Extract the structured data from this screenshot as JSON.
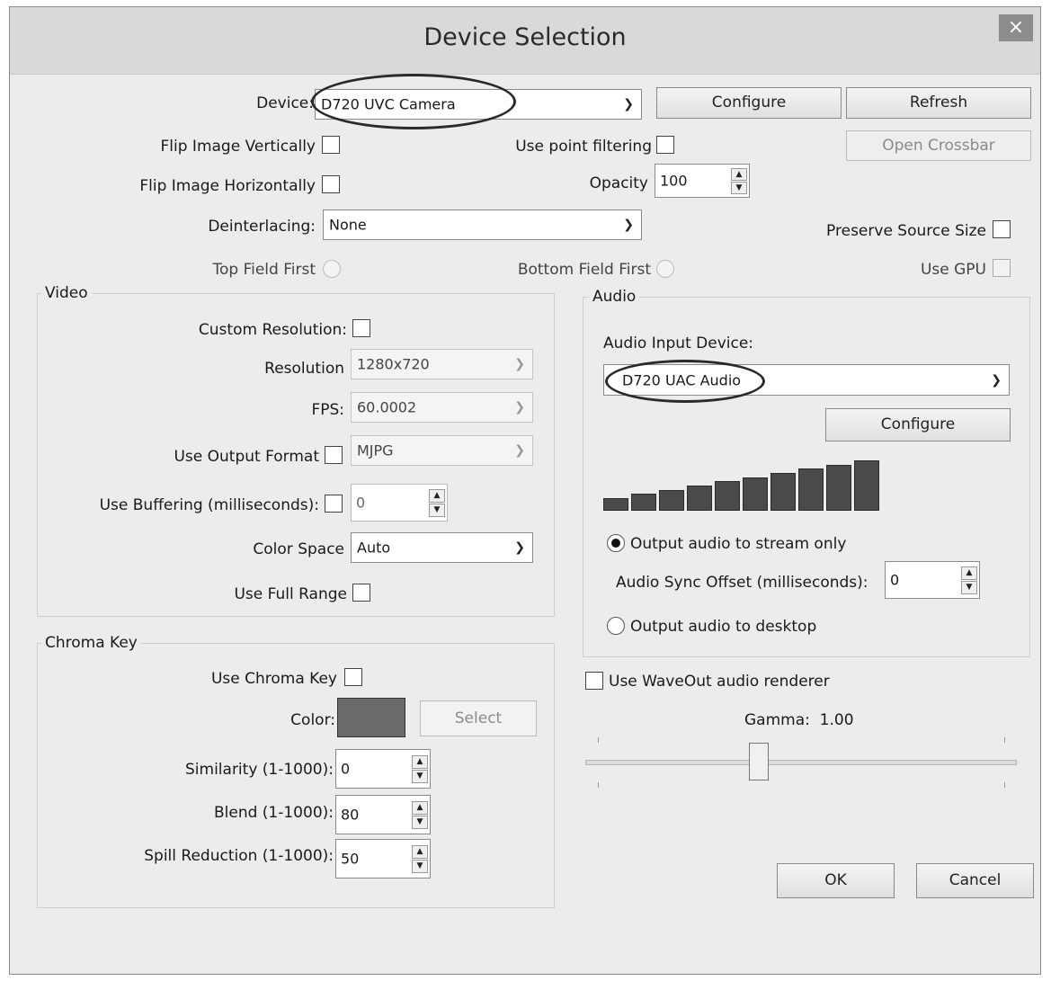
{
  "window": {
    "title": "Device Selection",
    "close_glyph": "×"
  },
  "device": {
    "label": "Device:",
    "selected": "D720 UVC Camera",
    "configure_label": "Configure",
    "refresh_label": "Refresh",
    "open_crossbar_label": "Open Crossbar"
  },
  "options": {
    "flip_vertical": "Flip Image Vertically",
    "flip_horizontal": "Flip Image Horizontally",
    "point_filtering": "Use point filtering",
    "opacity_label": "Opacity",
    "opacity_value": "100",
    "deinterlacing_label": "Deinterlacing:",
    "deinterlacing_value": "None",
    "preserve_source_size": "Preserve Source Size",
    "top_field_first": "Top Field First",
    "bottom_field_first": "Bottom Field First",
    "use_gpu": "Use GPU"
  },
  "video": {
    "group_title": "Video",
    "custom_resolution": "Custom Resolution:",
    "resolution_label": "Resolution",
    "resolution_value": "1280x720",
    "fps_label": "FPS:",
    "fps_value": "60.0002",
    "output_format_label": "Use Output Format",
    "output_format_value": "MJPG",
    "buffering_label": "Use Buffering (milliseconds):",
    "buffering_value": "0",
    "color_space_label": "Color Space",
    "color_space_value": "Auto",
    "full_range_label": "Use Full Range"
  },
  "chroma": {
    "group_title": "Chroma Key",
    "use_label": "Use Chroma Key",
    "color_label": "Color:",
    "swatch_color": "#6a6a6a",
    "select_label": "Select",
    "similarity_label": "Similarity (1-1000):",
    "similarity_value": "0",
    "blend_label": "Blend (1-1000):",
    "blend_value": "80",
    "spill_label": "Spill Reduction (1-1000):",
    "spill_value": "50"
  },
  "audio": {
    "group_title": "Audio",
    "input_label": "Audio Input Device:",
    "input_value": "D720 UAC Audio",
    "configure_label": "Configure",
    "meter_bar_count": 10,
    "meter_level": 1.0,
    "stream_only_label": "Output audio to stream only",
    "sync_label": "Audio Sync Offset (milliseconds):",
    "sync_value": "0",
    "desktop_label": "Output audio to desktop",
    "waveout_label": "Use WaveOut audio renderer",
    "gamma_label": "Gamma:",
    "gamma_value": "1.00"
  },
  "footer": {
    "ok_label": "OK",
    "cancel_label": "Cancel"
  },
  "colors": {
    "window_bg": "#ececec",
    "titlebar_bg": "#d9d9d9",
    "close_bg": "#8c8c8c"
  }
}
